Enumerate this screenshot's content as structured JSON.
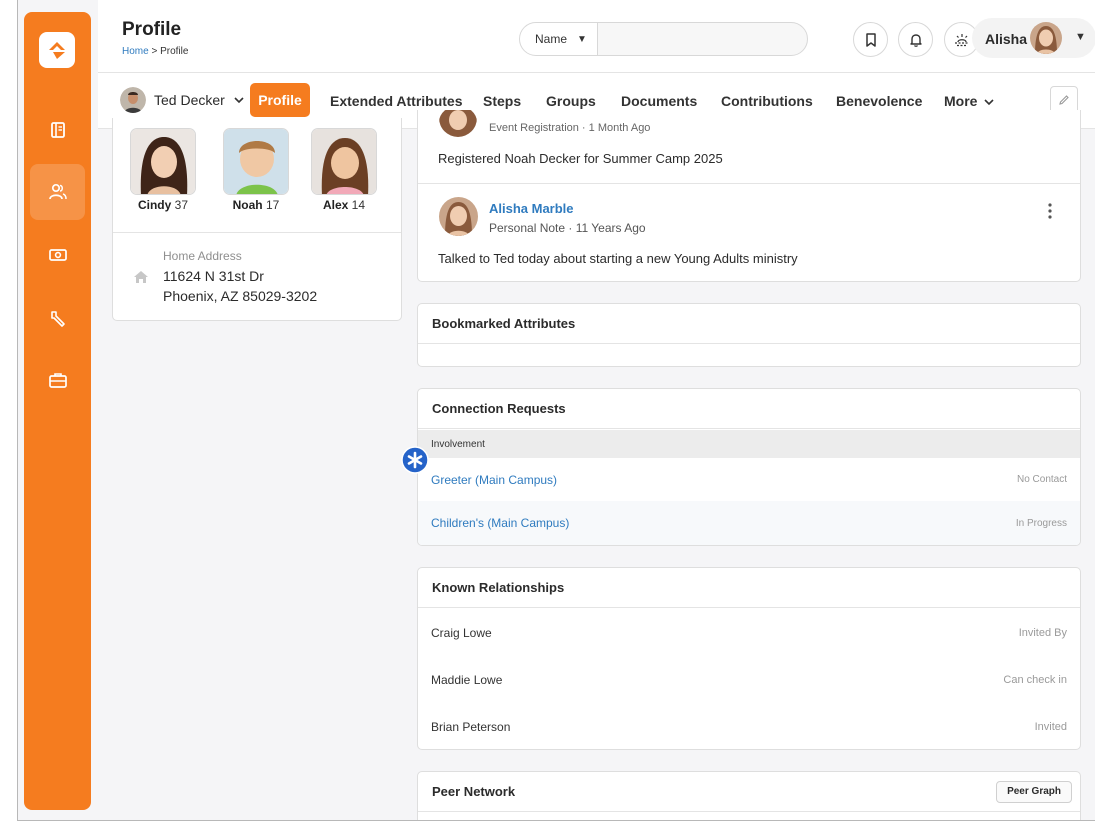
{
  "colors": {
    "accent": "#f57c1f",
    "link": "#2f7bbf",
    "marker": "#2563c9"
  },
  "header": {
    "title": "Profile",
    "crumb_home": "Home",
    "crumb_sep": " > ",
    "crumb_current": "Profile"
  },
  "search": {
    "type_label": "Name",
    "placeholder": ""
  },
  "user": {
    "name": "Alisha"
  },
  "sidebar": {
    "items": [
      {
        "icon": "book-icon"
      },
      {
        "icon": "people-icon"
      },
      {
        "icon": "cash-icon"
      },
      {
        "icon": "wrench-icon"
      },
      {
        "icon": "briefcase-icon"
      }
    ],
    "active_index": 1
  },
  "person": {
    "name": "Ted Decker"
  },
  "tabs": {
    "profile": "Profile",
    "extended": "Extended Attributes",
    "steps": "Steps",
    "groups": "Groups",
    "documents": "Documents",
    "contributions": "Contributions",
    "benevolence": "Benevolence",
    "more": "More"
  },
  "family": [
    {
      "name": "Cindy",
      "age": "37"
    },
    {
      "name": "Noah",
      "age": "17"
    },
    {
      "name": "Alex",
      "age": "14"
    }
  ],
  "address": {
    "label": "Home Address",
    "line1": "11624 N 31st Dr",
    "line2": "Phoenix, AZ 85029-3202"
  },
  "timeline": {
    "prev_meta": "Event Registration · 1 Month Ago",
    "prev_text": "Registered Noah Decker  for Summer Camp 2025",
    "note_author": "Alisha Marble",
    "note_meta": "Personal Note · 11 Years Ago",
    "note_text": "Talked to Ted today about starting a new Young Adults ministry"
  },
  "bookmarked": {
    "title": "Bookmarked Attributes"
  },
  "connections": {
    "title": "Connection Requests",
    "group": "Involvement",
    "items": [
      {
        "name": "Greeter (Main Campus)",
        "status": "No Contact"
      },
      {
        "name": "Children's (Main Campus)",
        "status": "In Progress"
      }
    ]
  },
  "relationships": {
    "title": "Known Relationships",
    "items": [
      {
        "name": "Craig Lowe",
        "rel": "Invited By"
      },
      {
        "name": "Maddie Lowe",
        "rel": "Can check in"
      },
      {
        "name": "Brian Peterson",
        "rel": "Invited"
      }
    ]
  },
  "peer": {
    "title": "Peer Network",
    "button": "Peer Graph"
  }
}
